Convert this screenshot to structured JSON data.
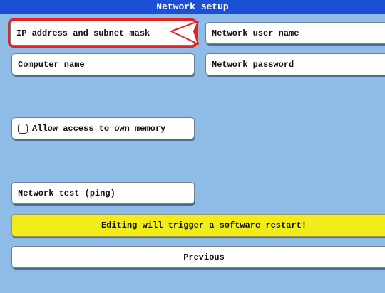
{
  "window": {
    "title": "Network setup"
  },
  "buttons": {
    "ip_address": "IP address and subnet mask",
    "network_user_name": "Network user name",
    "computer_name": "Computer name",
    "network_password": "Network password",
    "allow_access": "Allow access to own memory",
    "network_test": "Network test (ping)",
    "previous": "Previous"
  },
  "checkbox": {
    "allow_access_checked": false
  },
  "warning": {
    "text": "Editing will trigger a software restart!"
  },
  "colors": {
    "background": "#8fbce6",
    "titlebar": "#1a4fd6",
    "warning": "#f2ec1a",
    "highlight": "#e32222"
  },
  "icons": {
    "pointer": "arrow-pointer-icon",
    "checkbox": "checkbox-icon"
  }
}
